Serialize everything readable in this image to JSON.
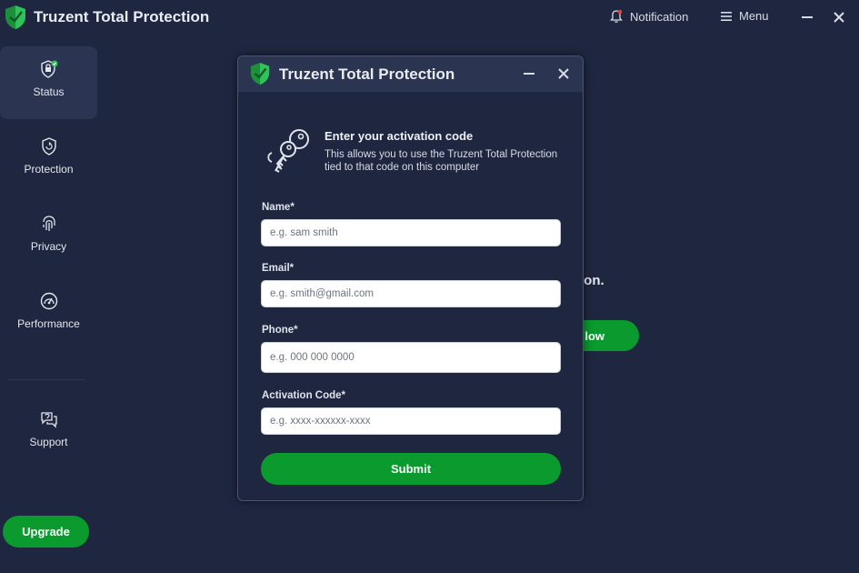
{
  "app": {
    "title": "Truzent Total Protection"
  },
  "titlebar": {
    "notification_label": "Notification",
    "menu_label": "Menu"
  },
  "sidebar": {
    "items": [
      {
        "label": "Status",
        "icon": "lock-shield-icon",
        "active": true
      },
      {
        "label": "Protection",
        "icon": "shield-refresh-icon"
      },
      {
        "label": "Privacy",
        "icon": "fingerprint-icon"
      },
      {
        "label": "Performance",
        "icon": "speedometer-icon"
      },
      {
        "label": "Support",
        "icon": "chat-help-icon"
      }
    ],
    "upgrade_label": "Upgrade"
  },
  "background": {
    "partial_text": "ion.",
    "partial_button": "low"
  },
  "dialog": {
    "title": "Truzent Total Protection",
    "heading": "Enter your activation code",
    "description": "This allows you to use the Truzent Total Protection tied to that code on this computer",
    "fields": {
      "name": {
        "label": "Name*",
        "placeholder": "e.g. sam smith"
      },
      "email": {
        "label": "Email*",
        "placeholder": "e.g. smith@gmail.com"
      },
      "phone": {
        "label": "Phone*",
        "placeholder": "e.g. 000 000 0000"
      },
      "code": {
        "label": "Activation Code*",
        "placeholder": "e.g. xxxx-xxxxxx-xxxx"
      }
    },
    "submit_label": "Submit"
  },
  "colors": {
    "background": "#1f2740",
    "panel": "#2b3450",
    "accent": "#0a9a2e",
    "brand_green": "#1fb84a"
  }
}
